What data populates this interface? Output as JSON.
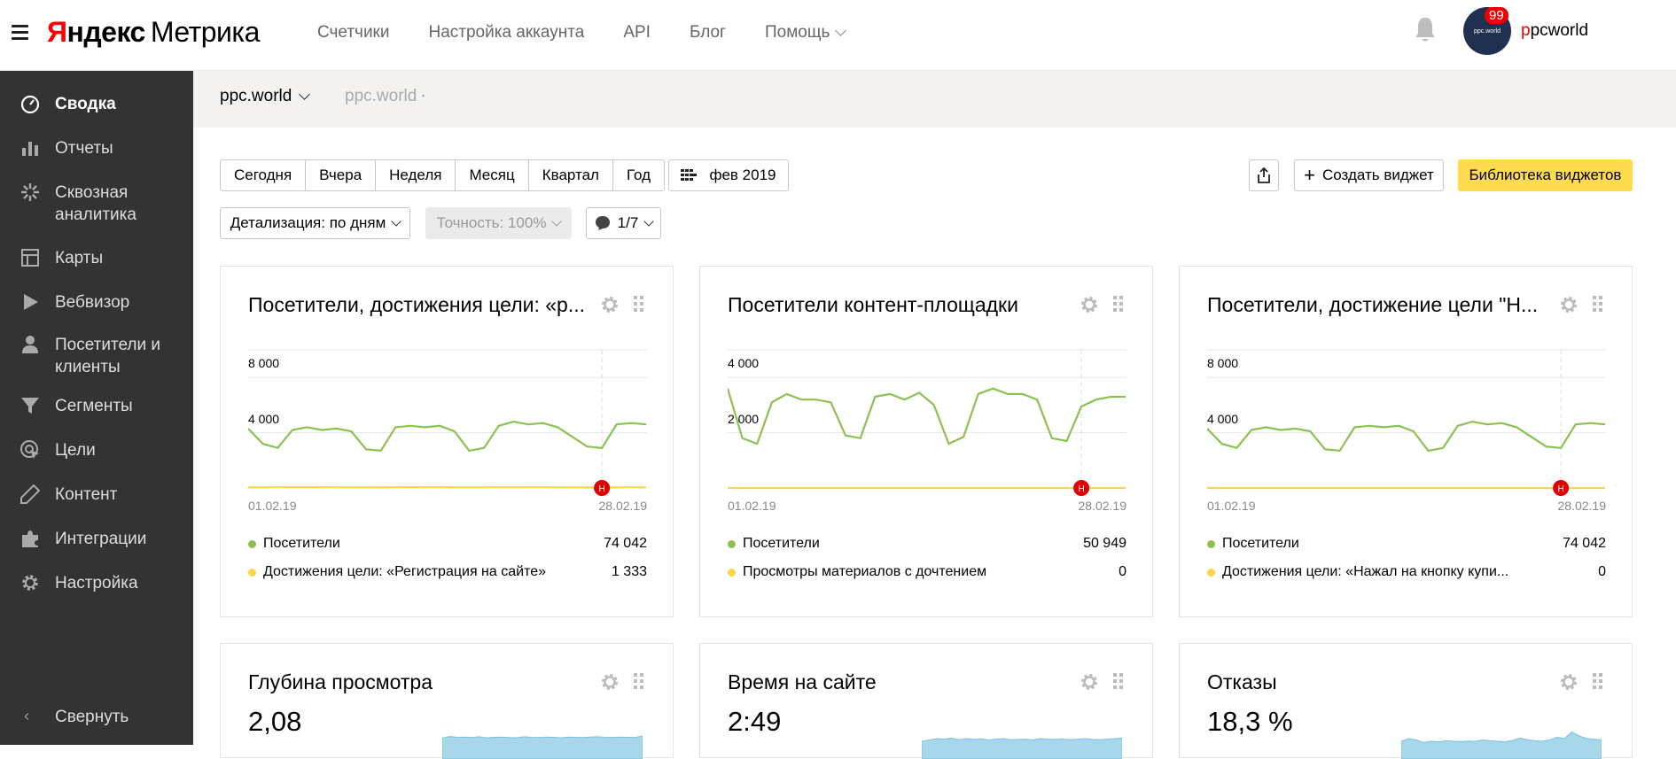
{
  "header": {
    "logo_ya": "Я",
    "logo_ya_rest": "ндекс",
    "logo_product": "Метрика",
    "nav": [
      "Счетчики",
      "Настройка аккаунта",
      "API",
      "Блог",
      "Помощь"
    ],
    "notification_count": "99",
    "avatar_text": "ppc.world",
    "username_first": "p",
    "username_rest": "pcworld"
  },
  "sidebar": {
    "items": [
      {
        "label": "Сводка",
        "icon": "dashboard-gauge-icon"
      },
      {
        "label": "Отчеты",
        "icon": "bar-chart-icon"
      },
      {
        "label": "Сквозная аналитика",
        "icon": "sparkle-icon"
      },
      {
        "label": "Карты",
        "icon": "map-layout-icon"
      },
      {
        "label": "Вебвизор",
        "icon": "play-icon"
      },
      {
        "label": "Посетители и клиенты",
        "icon": "user-icon"
      },
      {
        "label": "Сегменты",
        "icon": "filter-funnel-icon"
      },
      {
        "label": "Цели",
        "icon": "target-cursor-icon"
      },
      {
        "label": "Контент",
        "icon": "pencil-icon"
      },
      {
        "label": "Интеграции",
        "icon": "puzzle-icon"
      },
      {
        "label": "Настройка",
        "icon": "gear-icon"
      }
    ],
    "collapse_label": "Свернуть"
  },
  "subbar": {
    "counter": "ppc.world",
    "domain": "ppc.world"
  },
  "toolbar": {
    "periods": [
      "Сегодня",
      "Вчера",
      "Неделя",
      "Месяц",
      "Квартал",
      "Год"
    ],
    "date_range": "фев 2019",
    "detail_label": "Детализация: по дням",
    "accuracy_label": "Точность: 100%",
    "comments_label": "1/7",
    "create_widget": "Создать виджет",
    "widget_library": "Библиотека виджетов"
  },
  "colors": {
    "green": "#8cc152",
    "yellow": "#fdd54a",
    "blue_area": "#a7d7ea",
    "accent_yellow": "#ffdb4d",
    "sidebar_bg": "#333333",
    "marker_red": "#e00000"
  },
  "widgets": [
    {
      "title": "Посетители, достижения цели: «р...",
      "y_ticks": [
        "8 000",
        "4 000"
      ],
      "x_start": "01.02.19",
      "x_end": "28.02.19",
      "marker": "Н",
      "legend": [
        {
          "name": "Посетители",
          "value": "74 042"
        },
        {
          "name": "Достижения цели: «Регистрация на сайте»",
          "value": "1 333"
        }
      ],
      "chart_data": {
        "type": "line",
        "ylim": [
          0,
          10000
        ],
        "series": [
          {
            "name": "Посетители",
            "values": [
              4300,
              3200,
              2900,
              4200,
              4400,
              4200,
              4300,
              4100,
              2800,
              2700,
              4400,
              4500,
              4400,
              4500,
              4100,
              2700,
              2900,
              4500,
              4800,
              4600,
              4700,
              4400,
              3700,
              3000,
              2900,
              4600,
              4700,
              4600
            ]
          },
          {
            "name": "Достижения цели: «Регистрация на сайте»",
            "values": [
              40,
              45,
              50,
              60,
              55,
              50,
              48,
              47,
              44,
              40,
              50,
              55,
              52,
              50,
              48,
              45,
              44,
              50,
              53,
              52,
              50,
              48,
              45,
              40,
              38,
              48,
              50,
              47
            ]
          }
        ]
      }
    },
    {
      "title": "Посетители контент-площадки",
      "y_ticks": [
        "4 000",
        "2 000"
      ],
      "x_start": "01.02.19",
      "x_end": "28.02.19",
      "marker": "Н",
      "legend": [
        {
          "name": "Посетители",
          "value": "50 949"
        },
        {
          "name": "Просмотры материалов с дочтением",
          "value": "0"
        }
      ],
      "chart_data": {
        "type": "line",
        "ylim": [
          0,
          5000
        ],
        "series": [
          {
            "name": "Посетители",
            "values": [
              3600,
              1800,
              1600,
              3100,
              3400,
              3200,
              3200,
              3100,
              1900,
              1800,
              3300,
              3400,
              3200,
              3450,
              3000,
              1600,
              1850,
              3400,
              3600,
              3400,
              3400,
              3200,
              1800,
              1700,
              2950,
              3200,
              3300,
              3300
            ]
          },
          {
            "name": "Просмотры материалов с дочтением",
            "values": [
              0,
              0,
              0,
              0,
              0,
              0,
              0,
              0,
              0,
              0,
              0,
              0,
              0,
              0,
              0,
              0,
              0,
              0,
              0,
              0,
              0,
              0,
              0,
              0,
              0,
              0,
              0,
              0
            ]
          }
        ]
      }
    },
    {
      "title": "Посетители, достижение цели \"Н...",
      "y_ticks": [
        "8 000",
        "4 000"
      ],
      "x_start": "01.02.19",
      "x_end": "28.02.19",
      "marker": "Н",
      "legend": [
        {
          "name": "Посетители",
          "value": "74 042"
        },
        {
          "name": "Достижения цели: «Нажал на кнопку купи...",
          "value": "0"
        }
      ],
      "chart_data": {
        "type": "line",
        "ylim": [
          0,
          10000
        ],
        "series": [
          {
            "name": "Посетители",
            "values": [
              4300,
              3200,
              2900,
              4200,
              4400,
              4200,
              4300,
              4100,
              2800,
              2700,
              4400,
              4500,
              4400,
              4500,
              4100,
              2700,
              2900,
              4500,
              4800,
              4600,
              4700,
              4400,
              3700,
              3000,
              2900,
              4600,
              4700,
              4600
            ]
          },
          {
            "name": "Достижения цели: «Нажал на кнопку купи...",
            "values": [
              0,
              0,
              0,
              0,
              0,
              0,
              0,
              0,
              0,
              0,
              0,
              0,
              0,
              0,
              0,
              0,
              0,
              0,
              0,
              0,
              0,
              0,
              0,
              0,
              0,
              0,
              0,
              0
            ]
          }
        ]
      }
    }
  ],
  "metric_widgets": [
    {
      "title": "Глубина просмотра",
      "value": "2,08",
      "spark": [
        0.62,
        0.68,
        0.65,
        0.66,
        0.64,
        0.67,
        0.63,
        0.65,
        0.66,
        0.64,
        0.63,
        0.67,
        0.65,
        0.64,
        0.66,
        0.65,
        0.63,
        0.66,
        0.65,
        0.64,
        0.66,
        0.67,
        0.65,
        0.64,
        0.66,
        0.65,
        0.64,
        0.7
      ]
    },
    {
      "title": "Время на сайте",
      "value": "2:49",
      "spark": [
        0.5,
        0.55,
        0.6,
        0.58,
        0.62,
        0.56,
        0.6,
        0.57,
        0.59,
        0.55,
        0.58,
        0.6,
        0.56,
        0.57,
        0.58,
        0.55,
        0.6,
        0.58,
        0.57,
        0.59,
        0.56,
        0.58,
        0.6,
        0.57,
        0.56,
        0.58,
        0.6,
        0.62
      ]
    },
    {
      "title": "Отказы",
      "value": "18,3 %",
      "spark": [
        0.5,
        0.6,
        0.55,
        0.45,
        0.5,
        0.48,
        0.52,
        0.5,
        0.49,
        0.51,
        0.5,
        0.55,
        0.52,
        0.5,
        0.48,
        0.53,
        0.62,
        0.56,
        0.52,
        0.5,
        0.55,
        0.65,
        0.6,
        0.85,
        0.7,
        0.6,
        0.58,
        0.55
      ]
    }
  ]
}
